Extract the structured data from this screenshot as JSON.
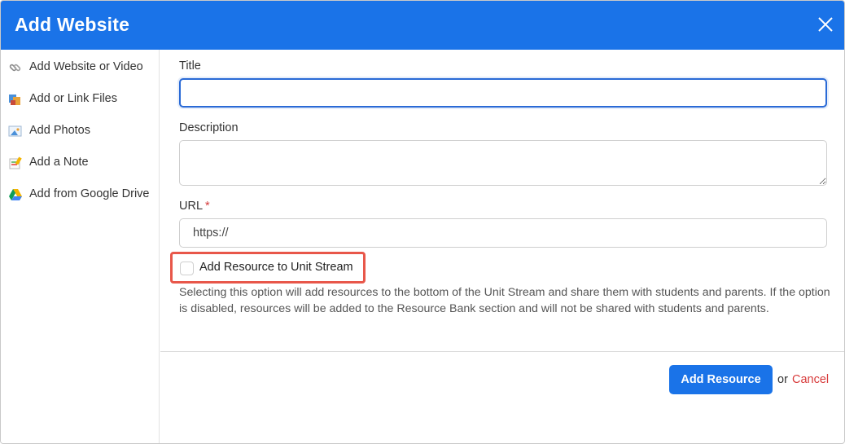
{
  "header": {
    "title": "Add Website"
  },
  "sidebar": {
    "items": [
      {
        "label": "Add Website or Video",
        "icon": "link-icon"
      },
      {
        "label": "Add or Link Files",
        "icon": "files-icon"
      },
      {
        "label": "Add Photos",
        "icon": "photo-icon"
      },
      {
        "label": "Add a Note",
        "icon": "note-icon"
      },
      {
        "label": "Add from Google Drive",
        "icon": "google-drive-icon"
      }
    ]
  },
  "form": {
    "title_label": "Title",
    "title_value": "",
    "description_label": "Description",
    "description_value": "",
    "url_label": "URL",
    "url_required_mark": "*",
    "url_value": "https://",
    "checkbox_label": "Add Resource to Unit Stream",
    "checkbox_checked": false,
    "helper_text": "Selecting this option will add resources to the bottom of the Unit Stream and share them with students and parents. If the option is disabled, resources will be added to the Resource Bank section and will not be shared with students and parents."
  },
  "footer": {
    "primary_label": "Add Resource",
    "or_text": "or",
    "cancel_label": "Cancel"
  },
  "colors": {
    "header_bg": "#1a73e8",
    "primary_btn": "#1a73e8",
    "cancel": "#d83b3b",
    "highlight": "#e8574a",
    "required": "#d43b3b"
  }
}
